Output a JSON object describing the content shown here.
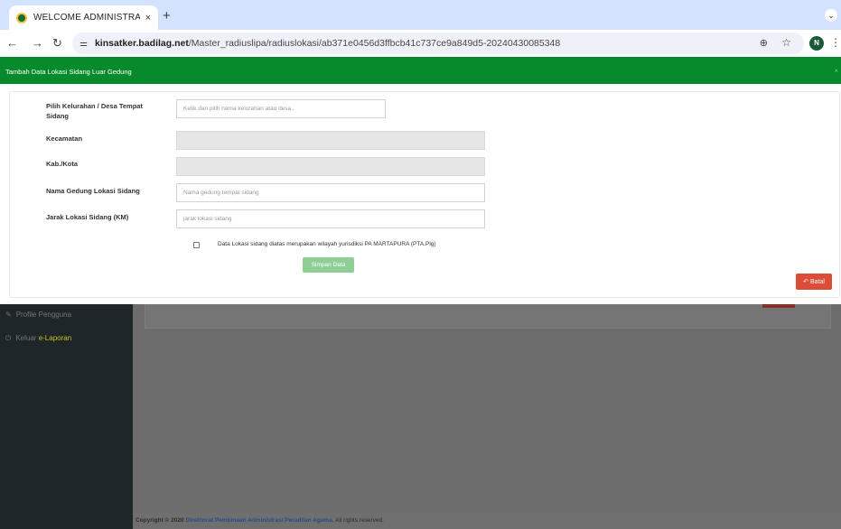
{
  "browser": {
    "tab_title": "WELCOME ADMINISTRATOR",
    "tab_close": "×",
    "new_tab": "+",
    "url_host": "kinsatker.badilag.net",
    "url_path": "/Master_radiuslipa/radiuslokasi/ab371e0456d3ffbcb41c737ce9a849d5-20240430085348",
    "profile_initial": "N"
  },
  "modal": {
    "header_title": "Tambah Data Lokasi Sidang Luar Gedung",
    "close_symbol": "×",
    "fields": [
      {
        "label": "Pilih Kelurahan / Desa Tempat Sidang",
        "value": "",
        "placeholder": "Ketik dan pilih nama kelurahan atau desa.."
      },
      {
        "label": "Kecamatan",
        "value": "",
        "placeholder": ""
      },
      {
        "label": "Kab./Kota",
        "value": "",
        "placeholder": ""
      },
      {
        "label": "Nama Gedung Lokasi Sidang",
        "value": "",
        "placeholder": "Nama gedung tempat sidang"
      },
      {
        "label": "Jarak Lokasi Sidang (KM)",
        "value": "",
        "placeholder": "jarak lokasi sidang"
      }
    ],
    "checkbox_label": "Data Lokasi sidang diatas merupakan wilayah yurisdiksi PA MARTAPURA (PTA.Plg)",
    "save_label": "Simpan Data",
    "cancel_label": "Batal"
  },
  "sidebar": {
    "items": [
      {
        "label": "Profile Pengguna"
      },
      {
        "label_prefix": "Keluar ",
        "label_highlight": "e-Laporan"
      }
    ]
  },
  "footer": {
    "copyright": "Copyright © 2020",
    "org": "Direktorat Pembinaan Administrasi Peradilan Agama",
    "rights": ". All rights reserved."
  },
  "colors": {
    "header_green": "#078a2c",
    "save_green": "#8fcf96",
    "cancel_red": "#dd4b39",
    "sidebar_dark": "#1e2629"
  },
  "icons": [
    "back-arrow-icon",
    "forward-arrow-icon",
    "reload-icon",
    "site-info-icon",
    "zoom-icon",
    "bookmark-star-icon",
    "kebab-menu-icon",
    "edit-icon",
    "power-icon",
    "undo-icon"
  ]
}
